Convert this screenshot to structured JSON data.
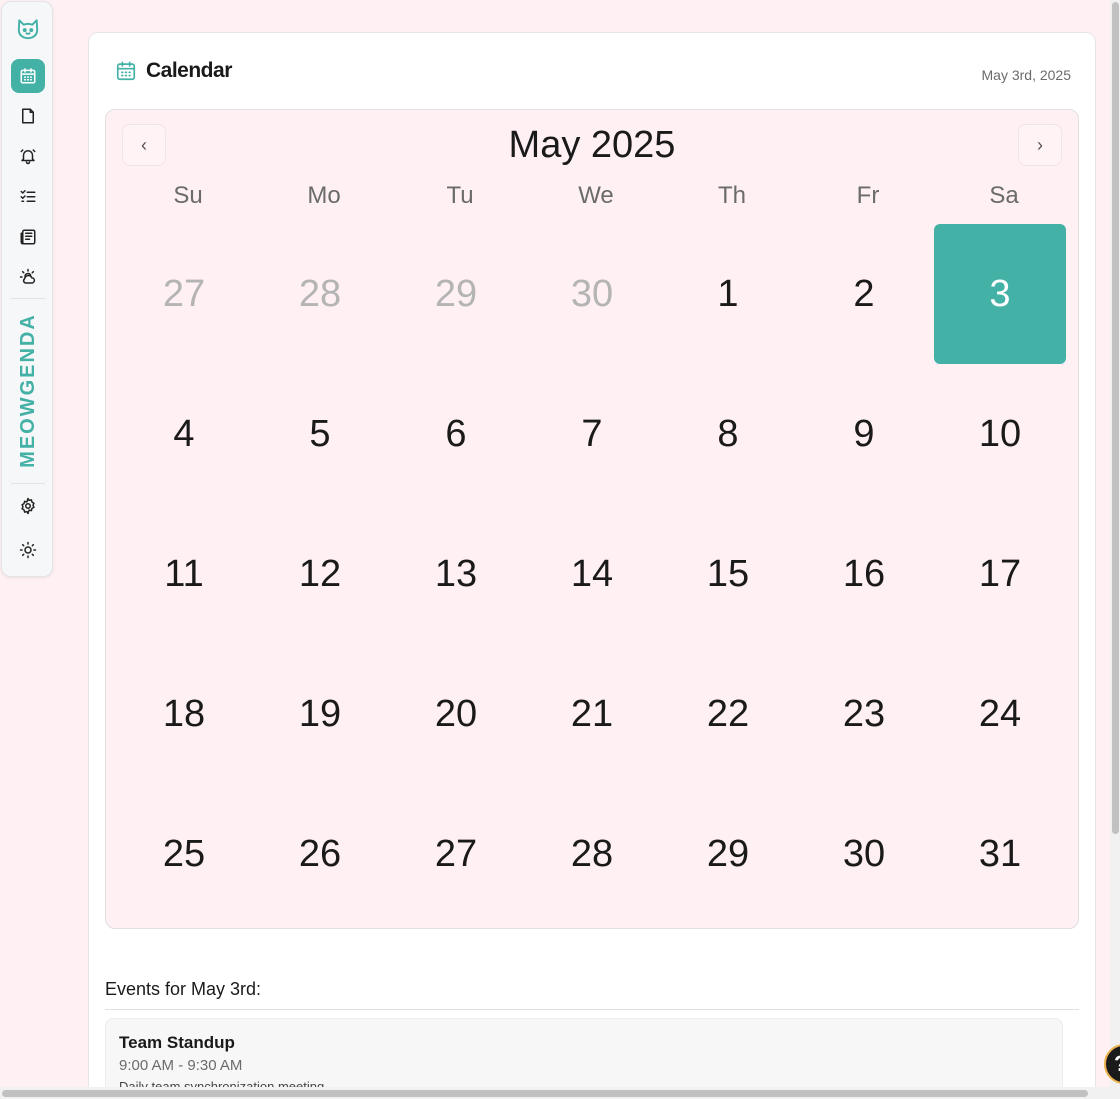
{
  "app": {
    "brand": "MEOWGENDA",
    "logo_icon": "cat-icon",
    "accent_color": "#44b1a7"
  },
  "sidebar": {
    "items": [
      {
        "name": "calendar",
        "icon": "calendar-icon",
        "active": true
      },
      {
        "name": "notes",
        "icon": "note-icon",
        "active": false
      },
      {
        "name": "reminders",
        "icon": "bell-icon",
        "active": false
      },
      {
        "name": "tasks",
        "icon": "checklist-icon",
        "active": false
      },
      {
        "name": "news",
        "icon": "newspaper-icon",
        "active": false
      },
      {
        "name": "weather",
        "icon": "weather-icon",
        "active": false
      }
    ],
    "bottom": [
      {
        "name": "settings",
        "icon": "gear-icon"
      },
      {
        "name": "theme",
        "icon": "sun-icon"
      }
    ]
  },
  "header": {
    "title": "Calendar",
    "date": "May 3rd, 2025"
  },
  "calendar": {
    "month_title": "May 2025",
    "prev_label": "‹",
    "next_label": "›",
    "weekdays": [
      "Su",
      "Mo",
      "Tu",
      "We",
      "Th",
      "Fr",
      "Sa"
    ],
    "days": [
      {
        "label": "27",
        "muted": true
      },
      {
        "label": "28",
        "muted": true
      },
      {
        "label": "29",
        "muted": true
      },
      {
        "label": "30",
        "muted": true
      },
      {
        "label": "1"
      },
      {
        "label": "2"
      },
      {
        "label": "3",
        "selected": true
      },
      {
        "label": "4"
      },
      {
        "label": "5"
      },
      {
        "label": "6"
      },
      {
        "label": "7"
      },
      {
        "label": "8"
      },
      {
        "label": "9"
      },
      {
        "label": "10"
      },
      {
        "label": "11"
      },
      {
        "label": "12"
      },
      {
        "label": "13"
      },
      {
        "label": "14"
      },
      {
        "label": "15"
      },
      {
        "label": "16"
      },
      {
        "label": "17"
      },
      {
        "label": "18"
      },
      {
        "label": "19"
      },
      {
        "label": "20"
      },
      {
        "label": "21"
      },
      {
        "label": "22"
      },
      {
        "label": "23"
      },
      {
        "label": "24"
      },
      {
        "label": "25"
      },
      {
        "label": "26"
      },
      {
        "label": "27"
      },
      {
        "label": "28"
      },
      {
        "label": "29"
      },
      {
        "label": "30"
      },
      {
        "label": "31"
      }
    ]
  },
  "events": {
    "title": "Events for May 3rd:",
    "items": [
      {
        "title": "Team Standup",
        "time": "9:00 AM - 9:30 AM",
        "description": "Daily team synchronization meeting"
      }
    ]
  },
  "help_label": "?"
}
